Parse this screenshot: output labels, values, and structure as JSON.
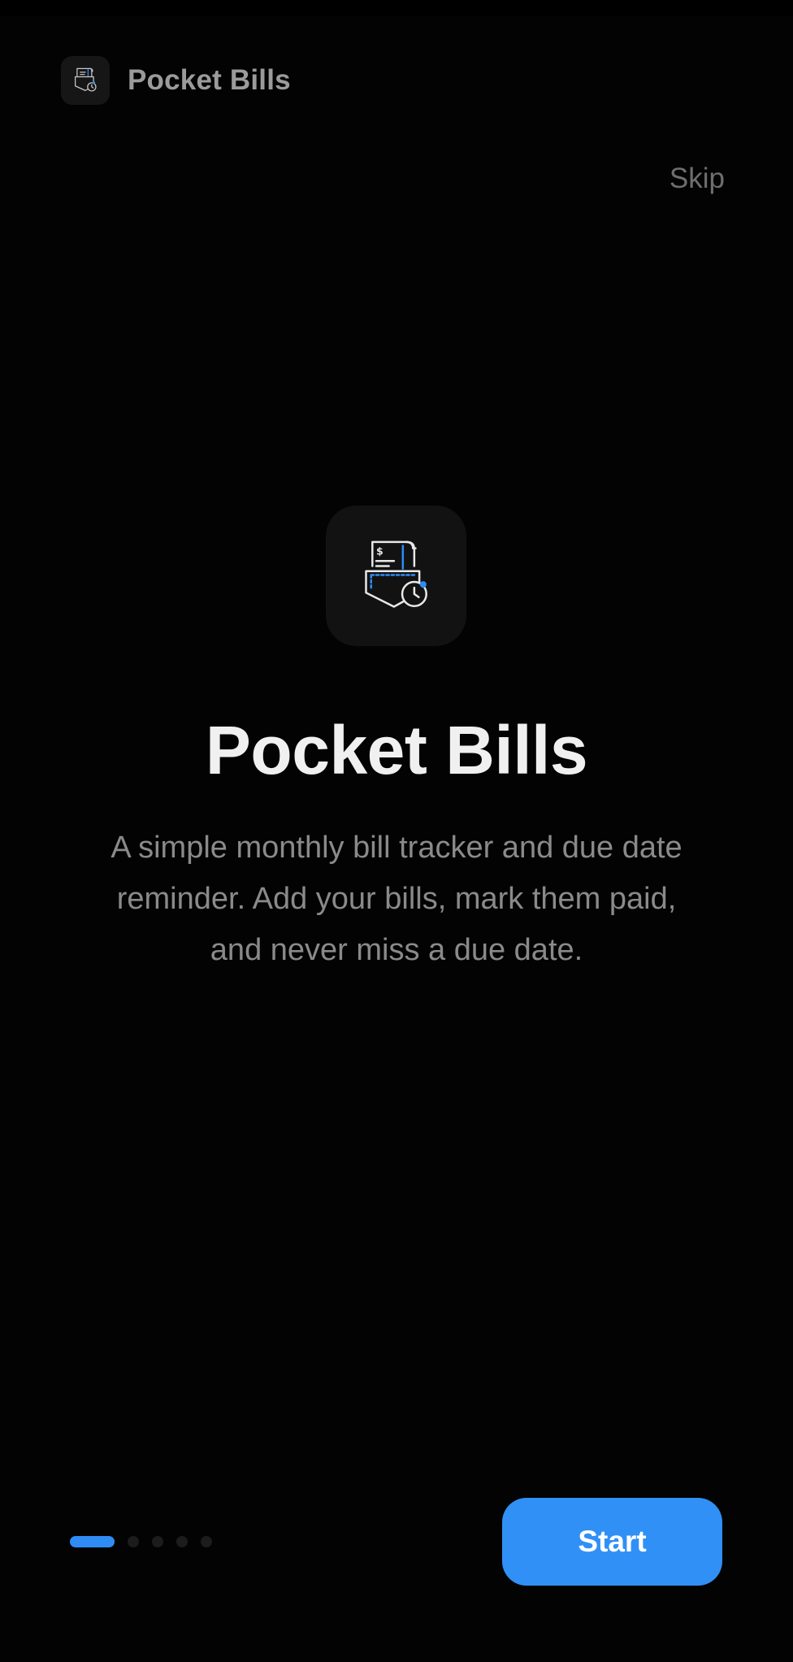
{
  "app": {
    "title": "Pocket Bills",
    "icon": "pocket-bill-clock-icon"
  },
  "onboarding": {
    "skip_label": "Skip",
    "hero_icon": "pocket-bill-clock-icon",
    "title": "Pocket Bills",
    "description": "A simple monthly bill tracker and due date reminder. Add your bills, mark them paid, and never miss a due date.",
    "page_index": 1,
    "page_count": 5,
    "start_label": "Start"
  },
  "colors": {
    "accent": "#2f8cf5",
    "background": "#030303",
    "title": "#f0f0f0",
    "muted": "#8a8a8a"
  }
}
